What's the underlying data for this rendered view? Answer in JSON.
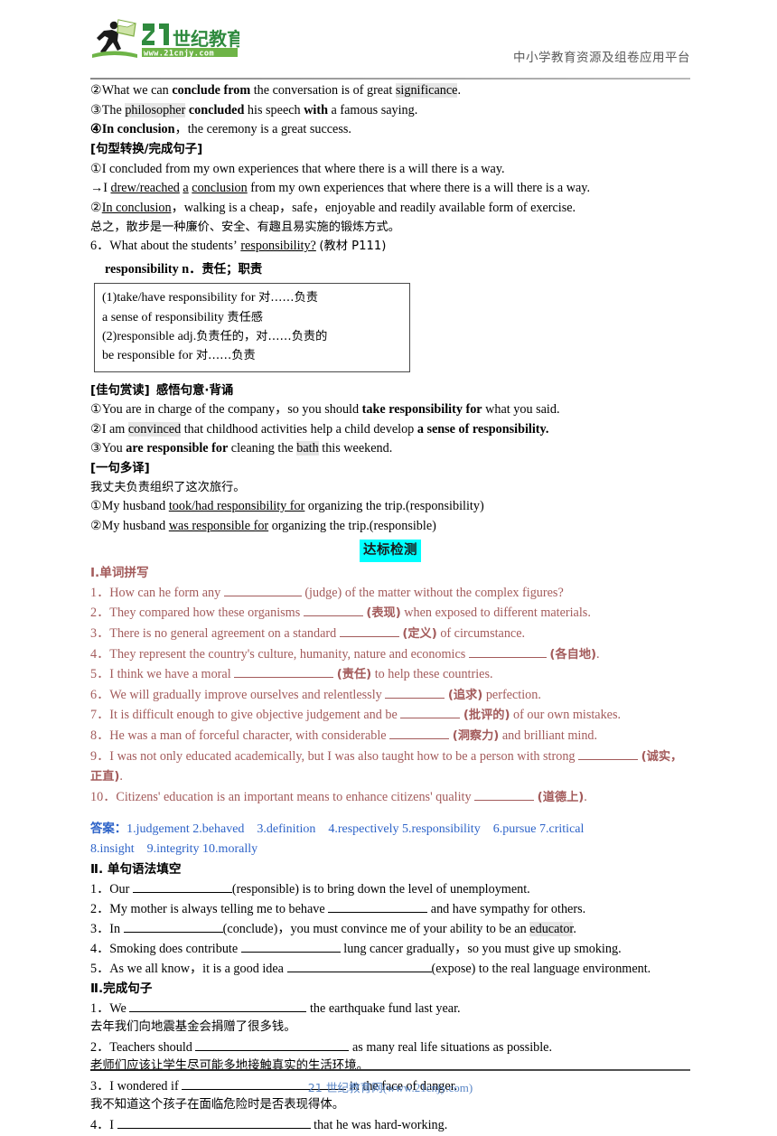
{
  "header": {
    "logo_number": "21",
    "logo_cn": "世纪教育",
    "logo_url": "www.21cnjy.com",
    "slogan": "中小学教育资源及组卷应用平台"
  },
  "examples": {
    "item2_pre": "②What we can ",
    "item2_b1": "conclude from",
    "item2_mid": " the conversation is of great ",
    "item2_hl": "significance",
    "item2_end": ".",
    "item3_pre": "③The ",
    "item3_hl": "philosopher",
    "item3_b1": " concluded",
    "item3_mid": " his speech ",
    "item3_b2": "with",
    "item3_end": " a famous saying.",
    "item4_b": "④In conclusion",
    "item4_end": "，the ceremony is a great success."
  },
  "transform": {
    "label": "[句型转换/完成句子]",
    "l1": "①I concluded from my own experiences that where there is a will there is a way.",
    "l2_pre": "→I ",
    "l2_u1": "drew/reached",
    "l2_mid1": " ",
    "l2_u2": "a",
    "l2_mid2": " ",
    "l2_u3": "conclusion",
    "l2_end": " from my own experiences that where there is a will there is a way.",
    "l3_pre": "②",
    "l3_u": "In conclusion",
    "l3_end": "，walking is a cheap，safe，enjoyable and readily available form of exercise.",
    "l4": "总之，散步是一种廉价、安全、有趣且易实施的锻炼方式。"
  },
  "entry6": {
    "num": "6．",
    "q_pre": "What about the students",
    "q_apos": "’",
    "q_u": "responsibility?",
    "q_src": "(教材 P111)",
    "word": "responsibility n",
    "word_dot": "．",
    "word_cn": "责任；职责",
    "box": [
      {
        "en": "(1)take/have responsibility for ",
        "cn": "对……负责"
      },
      {
        "en": "a sense of responsibility ",
        "cn": "责任感"
      },
      {
        "en": "(2)responsible adj.",
        "cn": "负责任的，对……负责的"
      },
      {
        "en": "be responsible for ",
        "cn": "对……负责"
      }
    ]
  },
  "good_sentences": {
    "label": "[佳句赏读]",
    "label2": "感悟句意·背诵",
    "s1_pre": "①You are in charge of the company，so you should ",
    "s1_b": "take responsibility for",
    "s1_end": " what you said.",
    "s2_pre": "②I am ",
    "s2_hl": "convinced",
    "s2_mid": " that childhood activities help a child develop ",
    "s2_b": "a sense of responsibility.",
    "s3_pre": "③You ",
    "s3_b": "are responsible for",
    "s3_mid": " cleaning the ",
    "s3_hl": "bath",
    "s3_end": " this weekend."
  },
  "multi_translate": {
    "label": "[一句多译]",
    "cn": "我丈夫负责组织了这次旅行。",
    "t1_pre": "①My husband ",
    "t1_u": "took/had responsibility for",
    "t1_end": " organizing the trip.(responsibility)",
    "t2_pre": "②My husband ",
    "t2_u": "was responsible for",
    "t2_end": " organizing the trip.(responsible)"
  },
  "test_badge": "达标检测",
  "section1": {
    "heading": "Ⅰ.单词拼写",
    "items": [
      {
        "num": "1．",
        "pre": "How can he form any ",
        "blank": "bl-l",
        "post_cn": "(judge)",
        "post": " of the matter without the complex figures?",
        "cn_hint": false
      },
      {
        "num": "2．",
        "pre": "They compared how these organisms ",
        "blank": "bl-m",
        "post_cn": "(表现)",
        "post": " when exposed to different materials.",
        "cn_hint": true
      },
      {
        "num": "3．",
        "pre": "There is no general agreement on a standard ",
        "blank": "bl-m",
        "post_cn": "(定义)",
        "post": " of circumstance.",
        "cn_hint": true
      },
      {
        "num": "4．",
        "pre": "They represent the country's culture, humanity, nature and economics ",
        "blank": "bl-l",
        "post_cn": "(各自地)",
        "post": ".",
        "cn_hint": true
      },
      {
        "num": "5．",
        "pre": "I think we have a moral ",
        "blank": "bl-xl",
        "post_cn": "(责任)",
        "post": " to help these countries.",
        "cn_hint": true
      },
      {
        "num": "6．",
        "pre": "We will gradually improve ourselves and relentlessly ",
        "blank": "bl-m",
        "post_cn": "(追求)",
        "post": " perfection.",
        "cn_hint": true
      },
      {
        "num": "7．",
        "pre": "It is difficult enough to give objective judgement and be ",
        "blank": "bl-m",
        "post_cn": "(批评的)",
        "post": " of our own mistakes.",
        "cn_hint": true
      },
      {
        "num": "8．",
        "pre": "He was a man of forceful character, with considerable ",
        "blank": "bl-m",
        "post_cn": "(洞察力)",
        "post": " and brilliant mind.",
        "cn_hint": true
      }
    ],
    "item9": {
      "num": "9．",
      "pre": "I was not only educated academically, but I was also taught how to be a person with strong ",
      "post_cn": "(诚实，正直)",
      "post": "."
    },
    "item10": {
      "num": "10．",
      "pre": "Citizens' education is an important means to enhance citizens' quality ",
      "post_cn": "(道德上)",
      "post": "."
    }
  },
  "answers": {
    "label": "答案：",
    "line1": "1.judgement 2.behaved　3.definition　4.respectively 5.responsibility　6.pursue 7.critical",
    "line2": "8.insight　9.integrity 10.morally"
  },
  "section2": {
    "heading": "Ⅱ. 单句语法填空",
    "items": [
      {
        "num": "1．",
        "pre": "Our ",
        "blank": "bl-xl",
        "post": "(responsible) is to bring down the level of unemployment."
      },
      {
        "num": "2．",
        "pre": "My mother is always telling me to behave ",
        "blank": "bl-xl",
        "post": " and have sympathy for others."
      },
      {
        "num": "3．",
        "pre": "In ",
        "blank": "bl-xl",
        "post": "(conclude)，you must convince me of your ability to be an ",
        "hl": "educator",
        "tail": "."
      },
      {
        "num": "4．",
        "pre": "Smoking does contribute ",
        "blank": "bl-xl",
        "post": " lung cancer gradually，so you must give up smoking."
      },
      {
        "num": "5．",
        "pre": "As we all know，it is a good idea ",
        "blank": "bl-xxl",
        "post": "(expose) to the real language environment."
      }
    ]
  },
  "section3": {
    "heading": "Ⅱ.完成句子",
    "items": [
      {
        "num": "1．",
        "pre": "We ",
        "blank": "bl-w1",
        "post": " the earthquake fund last year.",
        "cn": "去年我们向地震基金会捐赠了很多钱。"
      },
      {
        "num": "2．",
        "pre": "Teachers should ",
        "blank": "bl-w2",
        "post": " as many real life situations as possible.",
        "cn": "老师们应该让学生尽可能多地接触真实的生活环境。"
      },
      {
        "num": "3．",
        "pre": "I wondered if ",
        "blank": "bl-w3",
        "post": " in the face of danger.",
        "cn": "我不知道这个孩子在面临危险时是否表现得体。"
      },
      {
        "num": "4．",
        "pre": "I ",
        "blank": "bl-w4",
        "post": " that he was hard-working.",
        "cn": ""
      }
    ]
  },
  "footer": {
    "cn": "21 世纪教育网",
    "url": "(www.21cnjy.com)"
  },
  "colors": {
    "exercise_red": "#a35b5b",
    "answer_blue": "#2d63c8",
    "badge_cyan": "#00ffff",
    "logo_green": "#3f9b4b",
    "footer_blue": "#5a86c6"
  }
}
